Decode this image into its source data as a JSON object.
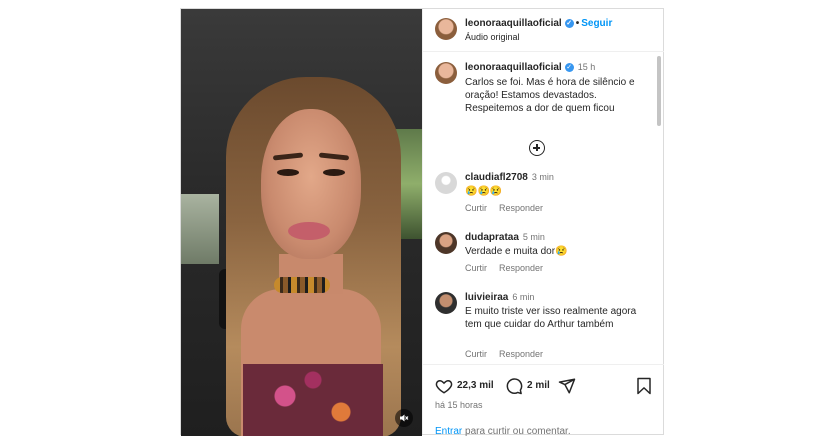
{
  "header": {
    "username": "leonoraaquillaoficial",
    "separator": "•",
    "follow_label": "Seguir",
    "audio_label": "Áudio original"
  },
  "caption": {
    "username": "leonoraaquillaoficial",
    "time": "15 h",
    "text": "Carlos se foi. Mas é hora de silêncio e oração! Estamos devastados. Respeitemos a dor de quem ficou"
  },
  "comments": [
    {
      "username": "claudiafl2708",
      "time": "3 min",
      "text": "😢😢😢",
      "like_label": "Curtir",
      "reply_label": "Responder"
    },
    {
      "username": "dudaprataa",
      "time": "5 min",
      "text": "Verdade e muita dor😢",
      "like_label": "Curtir",
      "reply_label": "Responder"
    },
    {
      "username": "luivieiraa",
      "time": "6 min",
      "text": "E muito triste ver isso realmente agora tem que cuidar do Arthur também",
      "like_label": "Curtir",
      "reply_label": "Responder"
    }
  ],
  "stats": {
    "likes": "22,3 mil",
    "comments": "2 mil",
    "posted_ago": "há 15 horas"
  },
  "login_prompt": {
    "link": "Entrar",
    "rest": " para curtir ou comentar."
  },
  "icons": {
    "like": "heart-icon",
    "comment": "comment-icon",
    "share": "share-icon",
    "save": "bookmark-icon",
    "add_comments": "plus-circle-icon",
    "verified": "verified-badge-icon",
    "mute": "speaker-muted-icon"
  },
  "colors": {
    "accent": "#0095f6",
    "verified": "#3897f0",
    "muted_text": "#737373"
  }
}
